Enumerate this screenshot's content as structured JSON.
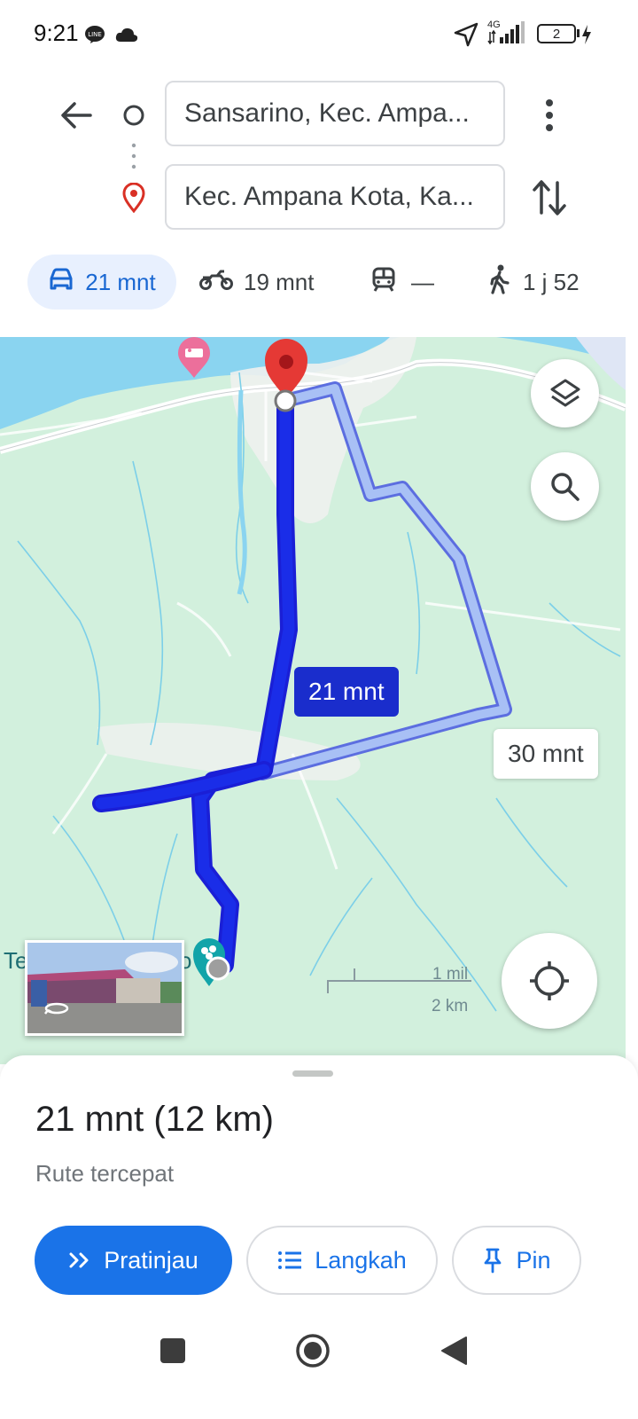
{
  "status_bar": {
    "time": "9:21",
    "network": "4G",
    "battery": "2",
    "icons": [
      "line-icon",
      "cloud-icon",
      "location-arrow-icon",
      "signal-icon",
      "battery-icon",
      "charging-icon"
    ]
  },
  "directions": {
    "origin": "Sansarino, Kec. Ampa...",
    "destination": "Kec. Ampana Kota, Ka...",
    "icons": [
      "back-arrow-icon",
      "origin-circle-icon",
      "destination-pin-icon",
      "more-vertical-icon",
      "swap-icon"
    ]
  },
  "modes": [
    {
      "icon": "car-icon",
      "label": "21 mnt",
      "selected": true
    },
    {
      "icon": "motorcycle-icon",
      "label": "19 mnt",
      "selected": false
    },
    {
      "icon": "transit-icon",
      "label": "—",
      "selected": false
    },
    {
      "icon": "walk-icon",
      "label": "1 j 52",
      "selected": false
    }
  ],
  "map": {
    "route_primary_label": "21 mnt",
    "route_alternate_label": "30 mnt",
    "poi_label_fragment": "Te",
    "poi_label_fragment_end": "o",
    "scale_mi": "1 mil",
    "scale_km": "2 km",
    "buttons": [
      "layers-icon",
      "search-icon",
      "my-location-icon"
    ]
  },
  "summary": {
    "title": "21 mnt (12 km)",
    "subtitle": "Rute tercepat"
  },
  "actions": {
    "preview": "Pratinjau",
    "steps": "Langkah",
    "pin": "Pin"
  },
  "colors": {
    "primary_blue": "#1a73e8",
    "route_blue": "#1a2de8",
    "route_alt": "#a8c0f5",
    "map_land": "#d2f0dd",
    "water": "#8ad4f0",
    "selected_mode_bg": "#e8f0fe"
  }
}
